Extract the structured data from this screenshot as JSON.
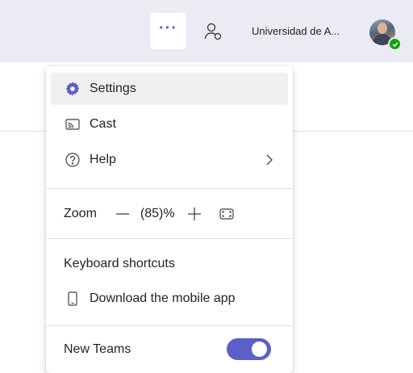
{
  "header": {
    "more_label": "···",
    "org_name": "Universidad de A...",
    "presence_status_color": "#13a10e",
    "accent_color": "#5b5fc7"
  },
  "menu": {
    "settings": "Settings",
    "cast": "Cast",
    "help": "Help",
    "zoom_label": "Zoom",
    "zoom_value": "(85)%",
    "keyboard_shortcuts": "Keyboard shortcuts",
    "download_app": "Download the mobile app",
    "new_teams": "New Teams",
    "new_teams_enabled": true
  },
  "icons": {
    "more": "more-horizontal-icon",
    "people": "people-icon",
    "settings": "gear-icon",
    "cast": "cast-icon",
    "help": "question-circle-icon",
    "help_submenu": "chevron-right-icon",
    "zoom_out": "minus-icon",
    "zoom_in": "plus-icon",
    "fullscreen": "full-screen-icon",
    "mobile": "phone-icon"
  }
}
